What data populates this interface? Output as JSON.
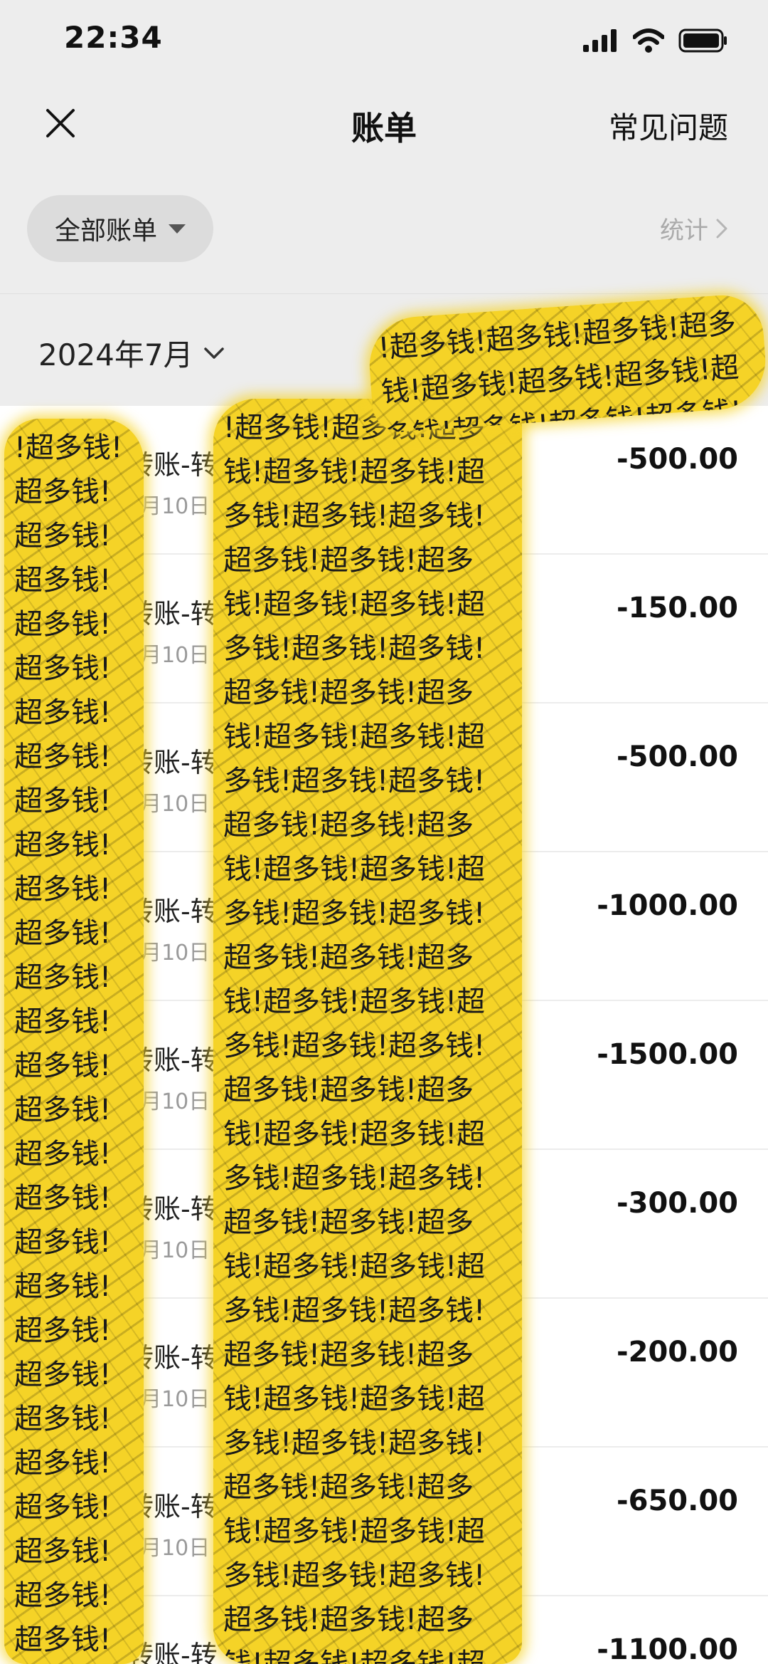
{
  "status": {
    "time": "22:34"
  },
  "nav": {
    "title": "账单",
    "faq": "常见问题"
  },
  "filter": {
    "label": "全部账单",
    "stats": "统计"
  },
  "month": {
    "label": "2024年7月"
  },
  "bills": [
    {
      "title": "转账-转给",
      "date": "7月10日 22",
      "amount": "-500.00"
    },
    {
      "title": "转账-转",
      "date": "7月10日 2",
      "amount": "-150.00"
    },
    {
      "title": "转账-转",
      "date": "7月10日 2",
      "amount": "-500.00"
    },
    {
      "title": "转账-转",
      "date": "7月10日",
      "amount": "-1000.00"
    },
    {
      "title": "转账-转",
      "date": "7月10日",
      "amount": "-1500.00"
    },
    {
      "title": "转账-转",
      "date": "7月10日",
      "amount": "-300.00"
    },
    {
      "title": "转账-转",
      "date": "7月10日",
      "amount": "-200.00"
    },
    {
      "title": "转账-转",
      "date": "7月10日",
      "amount": "-650.00"
    },
    {
      "title": "转账-转",
      "date": "",
      "amount": "-1100.00"
    }
  ],
  "sticker": {
    "text": "!超多钱!超多钱!超多钱!超多钱!超多钱!超多钱!超多钱!超多钱!超多钱!超多钱!超多钱!超多钱!超多钱!超多钱!超多钱!超多钱!超多钱!超多钱!超多钱!超多钱!超多钱!超多钱!超多钱!超多钱!超多钱!超多钱!超多钱!超多钱!超多钱!超多钱!超多钱!超多钱!超多钱!超多钱!超多钱!超多钱!超多钱!超多钱!超多钱!超多钱!超多钱!超多钱!超多钱!超多钱!超多钱!超多钱!超多钱!超多钱!超多钱!超多钱!超多钱!超多钱!超多钱!超多钱!超多钱!超多钱!超多钱!超多钱!超多钱!超多钱!超多钱!超多钱!超多钱!超多钱!超多钱!超多钱!超多钱!超多钱!超多钱!超多钱!超多钱!超多钱!超多钱!超多钱!超多钱!超多钱!超多钱!超多钱!超多钱!超多钱!超多钱!超多钱!超多钱!超多钱!超多钱!超多钱!超多钱!超多钱!超多钱!超多钱!超多钱!超多钱!超多钱!超多钱!超多钱!超多钱!超多钱!超多钱!超多钱!超多钱"
  }
}
